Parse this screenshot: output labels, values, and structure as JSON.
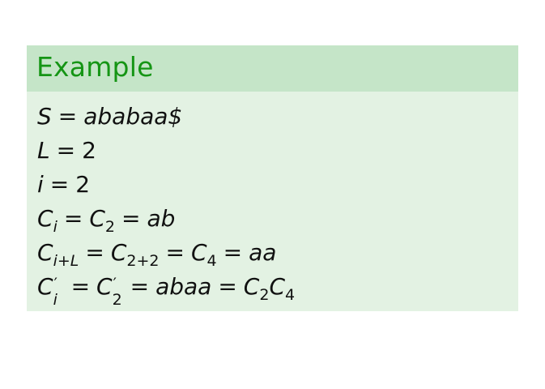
{
  "block": {
    "title": "Example"
  },
  "lines": {
    "l1": {
      "lhs": "S",
      "eq": "=",
      "rhs": "ababaa$"
    },
    "l2": {
      "lhs": "L",
      "eq": "=",
      "rhs": "2"
    },
    "l3": {
      "lhs": "i",
      "eq": "=",
      "rhs": "2"
    },
    "l4": {
      "c1": "C",
      "c1_sub": "i",
      "eq1": "=",
      "c2": "C",
      "c2_sub": "2",
      "eq2": "=",
      "rhs": "ab"
    },
    "l5": {
      "c1": "C",
      "c1_sub": "i+L",
      "eq1": "=",
      "c2": "C",
      "c2_sub": "2+2",
      "eq2": "=",
      "c3": "C",
      "c3_sub": "4",
      "eq3": "=",
      "rhs": "aa"
    },
    "l6": {
      "c1": "C",
      "c1_sup": "′",
      "c1_sub": "i",
      "eq1": "=",
      "c2": "C",
      "c2_sup": "′",
      "c2_sub": "2",
      "eq2": "=",
      "mid": "abaa",
      "eq3": "=",
      "c3": "C",
      "c3_sub": "2",
      "c4": "C",
      "c4_sub": "4"
    }
  },
  "colors": {
    "header_bg": "#c5e5c8",
    "body_bg": "#e3f2e3",
    "title": "#159515"
  }
}
